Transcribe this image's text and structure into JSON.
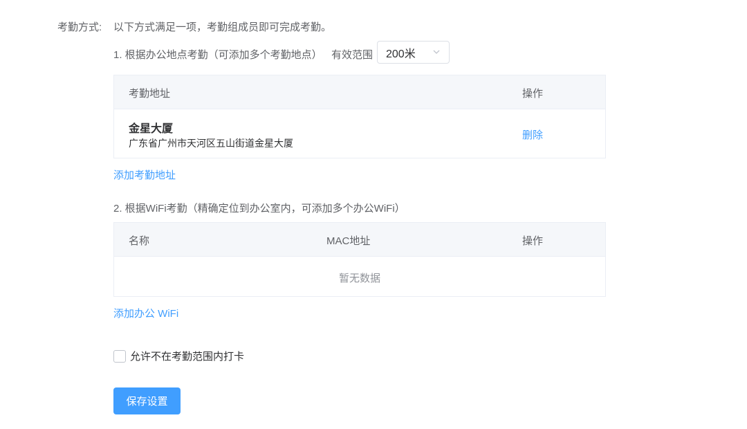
{
  "attendance": {
    "method_label": "考勤方式:",
    "method_desc": "以下方式满足一项，考勤组成员即可完成考勤。"
  },
  "location_section": {
    "title": "1. 根据办公地点考勤（可添加多个考勤地点）",
    "range_label": "有效范围",
    "range_value": "200米",
    "columns": {
      "address": "考勤地址",
      "action": "操作"
    },
    "rows": [
      {
        "name": "金星大厦",
        "address": "广东省广州市天河区五山街道金星大厦",
        "action": "删除"
      }
    ],
    "add_link": "添加考勤地址"
  },
  "wifi_section": {
    "title": "2. 根据WiFi考勤（精确定位到办公室内，可添加多个办公WiFi）",
    "columns": {
      "name": "名称",
      "mac": "MAC地址",
      "action": "操作"
    },
    "empty_text": "暂无数据",
    "add_link": "添加办公 WiFi"
  },
  "allow_out_of_range": {
    "label": "允许不在考勤范围内打卡",
    "checked": false
  },
  "save_button": "保存设置",
  "colors": {
    "primary": "#409eff",
    "text": "#606266",
    "border": "#ebeef5",
    "header_bg": "#f5f7fa"
  }
}
